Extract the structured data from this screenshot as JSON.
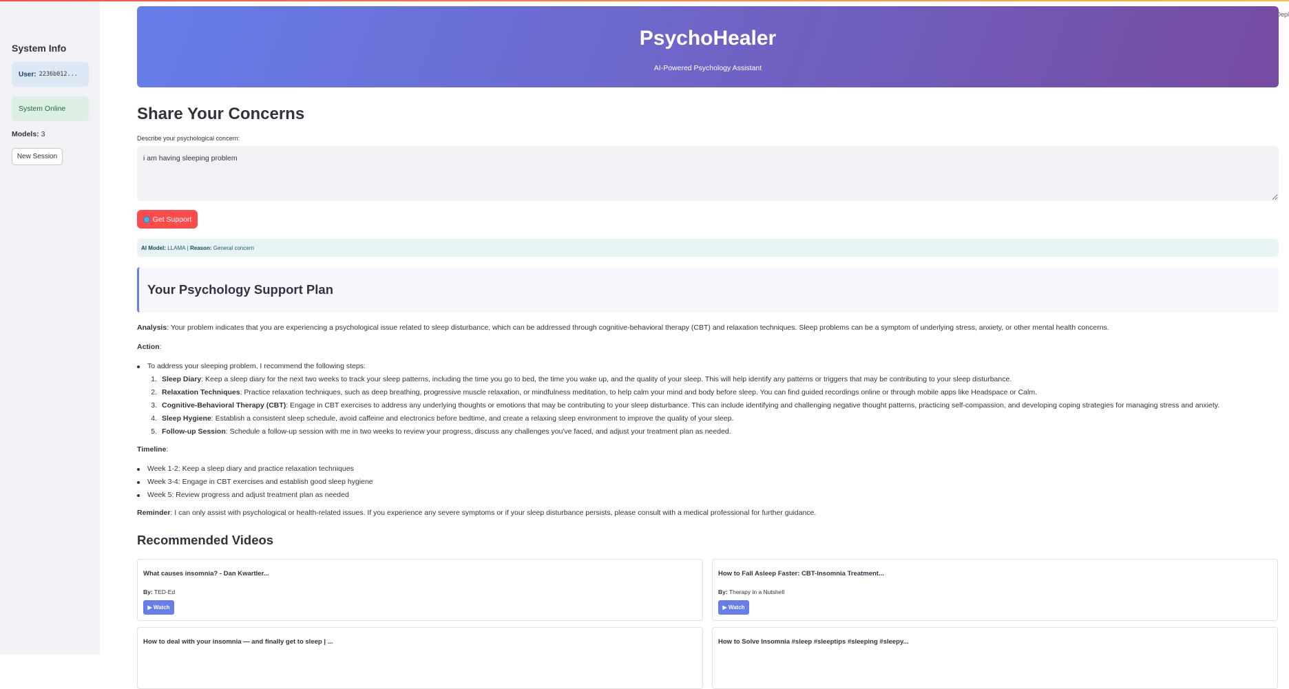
{
  "deploy_label": "Depl",
  "sidebar": {
    "title": "System Info",
    "user_label": "User:",
    "user_id": "2236b012...",
    "status": "System Online",
    "models_label": "Models:",
    "models_count": "3",
    "new_session": "New Session"
  },
  "header": {
    "title": "PsychoHealer",
    "subtitle": "AI-Powered Psychology Assistant"
  },
  "form": {
    "heading": "Share Your Concerns",
    "label": "Describe your psychological concern:",
    "value": "i am having sleeping problem",
    "submit": "Get Support"
  },
  "model_info": {
    "model_label": "AI Model:",
    "model_value": "LLAMA",
    "separator": " | ",
    "reason_label": "Reason:",
    "reason_value": "General concern"
  },
  "plan": {
    "title": "Your Psychology Support Plan",
    "analysis_label": "Analysis",
    "analysis_text": ": Your problem indicates that you are experiencing a psychological issue related to sleep disturbance, which can be addressed through cognitive-behavioral therapy (CBT) and relaxation techniques. Sleep problems can be a symptom of underlying stress, anxiety, or other mental health concerns.",
    "action_label": "Action",
    "action_intro": "To address your sleeping problem, I recommend the following steps:",
    "steps": [
      {
        "n": "1.",
        "label": "Sleep Diary",
        "text": ": Keep a sleep diary for the next two weeks to track your sleep patterns, including the time you go to bed, the time you wake up, and the quality of your sleep. This will help identify any patterns or triggers that may be contributing to your sleep disturbance."
      },
      {
        "n": "2.",
        "label": "Relaxation Techniques",
        "text": ": Practice relaxation techniques, such as deep breathing, progressive muscle relaxation, or mindfulness meditation, to help calm your mind and body before sleep. You can find guided recordings online or through mobile apps like Headspace or Calm."
      },
      {
        "n": "3.",
        "label": "Cognitive-Behavioral Therapy (CBT)",
        "text": ": Engage in CBT exercises to address any underlying thoughts or emotions that may be contributing to your sleep disturbance. This can include identifying and challenging negative thought patterns, practicing self-compassion, and developing coping strategies for managing stress and anxiety."
      },
      {
        "n": "4.",
        "label": "Sleep Hygiene",
        "text": ": Establish a consistent sleep schedule, avoid caffeine and electronics before bedtime, and create a relaxing sleep environment to improve the quality of your sleep."
      },
      {
        "n": "5.",
        "label": "Follow-up Session",
        "text": ": Schedule a follow-up session with me in two weeks to review your progress, discuss any challenges you've faced, and adjust your treatment plan as needed."
      }
    ],
    "timeline_label": "Timeline",
    "timeline": [
      "Week 1-2: Keep a sleep diary and practice relaxation techniques",
      "Week 3-4: Engage in CBT exercises and establish good sleep hygiene",
      "Week 5: Review progress and adjust treatment plan as needed"
    ],
    "reminder_label": "Reminder",
    "reminder_text": ": I can only assist with psychological or health-related issues. If you experience any severe symptoms or if your sleep disturbance persists, please consult with a medical professional for further guidance."
  },
  "videos": {
    "heading": "Recommended Videos",
    "by_label": "By:",
    "watch_label": "▶ Watch",
    "items": [
      {
        "title": "What causes insomnia? - Dan Kwartler...",
        "by": "TED-Ed"
      },
      {
        "title": "How to Fall Asleep Faster: CBT-Insomnia Treatment...",
        "by": "Therapy in a Nutshell"
      },
      {
        "title": "How to deal with your insomnia — and finally get to sleep | ..."
      },
      {
        "title": "How to Solve Insomnia #sleep #sleeptips #sleeping #sleepy..."
      }
    ]
  }
}
